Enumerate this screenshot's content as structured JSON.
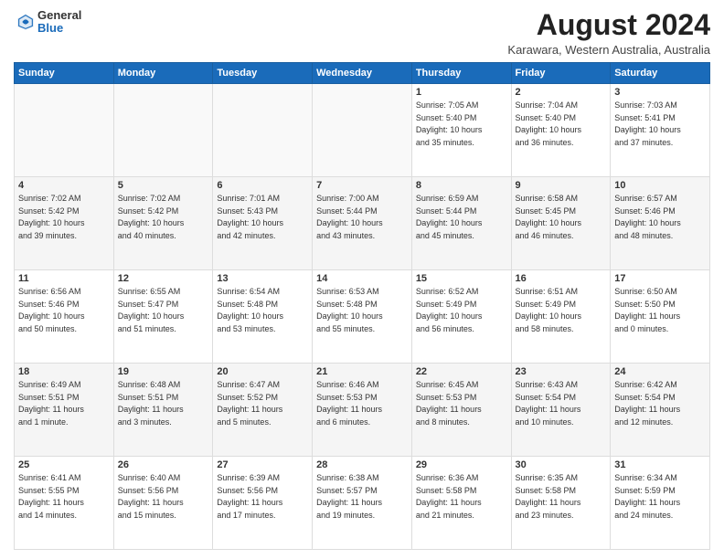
{
  "logo": {
    "general": "General",
    "blue": "Blue"
  },
  "title": "August 2024",
  "location": "Karawara, Western Australia, Australia",
  "days_of_week": [
    "Sunday",
    "Monday",
    "Tuesday",
    "Wednesday",
    "Thursday",
    "Friday",
    "Saturday"
  ],
  "weeks": [
    [
      {
        "day": "",
        "info": ""
      },
      {
        "day": "",
        "info": ""
      },
      {
        "day": "",
        "info": ""
      },
      {
        "day": "",
        "info": ""
      },
      {
        "day": "1",
        "info": "Sunrise: 7:05 AM\nSunset: 5:40 PM\nDaylight: 10 hours\nand 35 minutes."
      },
      {
        "day": "2",
        "info": "Sunrise: 7:04 AM\nSunset: 5:40 PM\nDaylight: 10 hours\nand 36 minutes."
      },
      {
        "day": "3",
        "info": "Sunrise: 7:03 AM\nSunset: 5:41 PM\nDaylight: 10 hours\nand 37 minutes."
      }
    ],
    [
      {
        "day": "4",
        "info": "Sunrise: 7:02 AM\nSunset: 5:42 PM\nDaylight: 10 hours\nand 39 minutes."
      },
      {
        "day": "5",
        "info": "Sunrise: 7:02 AM\nSunset: 5:42 PM\nDaylight: 10 hours\nand 40 minutes."
      },
      {
        "day": "6",
        "info": "Sunrise: 7:01 AM\nSunset: 5:43 PM\nDaylight: 10 hours\nand 42 minutes."
      },
      {
        "day": "7",
        "info": "Sunrise: 7:00 AM\nSunset: 5:44 PM\nDaylight: 10 hours\nand 43 minutes."
      },
      {
        "day": "8",
        "info": "Sunrise: 6:59 AM\nSunset: 5:44 PM\nDaylight: 10 hours\nand 45 minutes."
      },
      {
        "day": "9",
        "info": "Sunrise: 6:58 AM\nSunset: 5:45 PM\nDaylight: 10 hours\nand 46 minutes."
      },
      {
        "day": "10",
        "info": "Sunrise: 6:57 AM\nSunset: 5:46 PM\nDaylight: 10 hours\nand 48 minutes."
      }
    ],
    [
      {
        "day": "11",
        "info": "Sunrise: 6:56 AM\nSunset: 5:46 PM\nDaylight: 10 hours\nand 50 minutes."
      },
      {
        "day": "12",
        "info": "Sunrise: 6:55 AM\nSunset: 5:47 PM\nDaylight: 10 hours\nand 51 minutes."
      },
      {
        "day": "13",
        "info": "Sunrise: 6:54 AM\nSunset: 5:48 PM\nDaylight: 10 hours\nand 53 minutes."
      },
      {
        "day": "14",
        "info": "Sunrise: 6:53 AM\nSunset: 5:48 PM\nDaylight: 10 hours\nand 55 minutes."
      },
      {
        "day": "15",
        "info": "Sunrise: 6:52 AM\nSunset: 5:49 PM\nDaylight: 10 hours\nand 56 minutes."
      },
      {
        "day": "16",
        "info": "Sunrise: 6:51 AM\nSunset: 5:49 PM\nDaylight: 10 hours\nand 58 minutes."
      },
      {
        "day": "17",
        "info": "Sunrise: 6:50 AM\nSunset: 5:50 PM\nDaylight: 11 hours\nand 0 minutes."
      }
    ],
    [
      {
        "day": "18",
        "info": "Sunrise: 6:49 AM\nSunset: 5:51 PM\nDaylight: 11 hours\nand 1 minute."
      },
      {
        "day": "19",
        "info": "Sunrise: 6:48 AM\nSunset: 5:51 PM\nDaylight: 11 hours\nand 3 minutes."
      },
      {
        "day": "20",
        "info": "Sunrise: 6:47 AM\nSunset: 5:52 PM\nDaylight: 11 hours\nand 5 minutes."
      },
      {
        "day": "21",
        "info": "Sunrise: 6:46 AM\nSunset: 5:53 PM\nDaylight: 11 hours\nand 6 minutes."
      },
      {
        "day": "22",
        "info": "Sunrise: 6:45 AM\nSunset: 5:53 PM\nDaylight: 11 hours\nand 8 minutes."
      },
      {
        "day": "23",
        "info": "Sunrise: 6:43 AM\nSunset: 5:54 PM\nDaylight: 11 hours\nand 10 minutes."
      },
      {
        "day": "24",
        "info": "Sunrise: 6:42 AM\nSunset: 5:54 PM\nDaylight: 11 hours\nand 12 minutes."
      }
    ],
    [
      {
        "day": "25",
        "info": "Sunrise: 6:41 AM\nSunset: 5:55 PM\nDaylight: 11 hours\nand 14 minutes."
      },
      {
        "day": "26",
        "info": "Sunrise: 6:40 AM\nSunset: 5:56 PM\nDaylight: 11 hours\nand 15 minutes."
      },
      {
        "day": "27",
        "info": "Sunrise: 6:39 AM\nSunset: 5:56 PM\nDaylight: 11 hours\nand 17 minutes."
      },
      {
        "day": "28",
        "info": "Sunrise: 6:38 AM\nSunset: 5:57 PM\nDaylight: 11 hours\nand 19 minutes."
      },
      {
        "day": "29",
        "info": "Sunrise: 6:36 AM\nSunset: 5:58 PM\nDaylight: 11 hours\nand 21 minutes."
      },
      {
        "day": "30",
        "info": "Sunrise: 6:35 AM\nSunset: 5:58 PM\nDaylight: 11 hours\nand 23 minutes."
      },
      {
        "day": "31",
        "info": "Sunrise: 6:34 AM\nSunset: 5:59 PM\nDaylight: 11 hours\nand 24 minutes."
      }
    ]
  ]
}
